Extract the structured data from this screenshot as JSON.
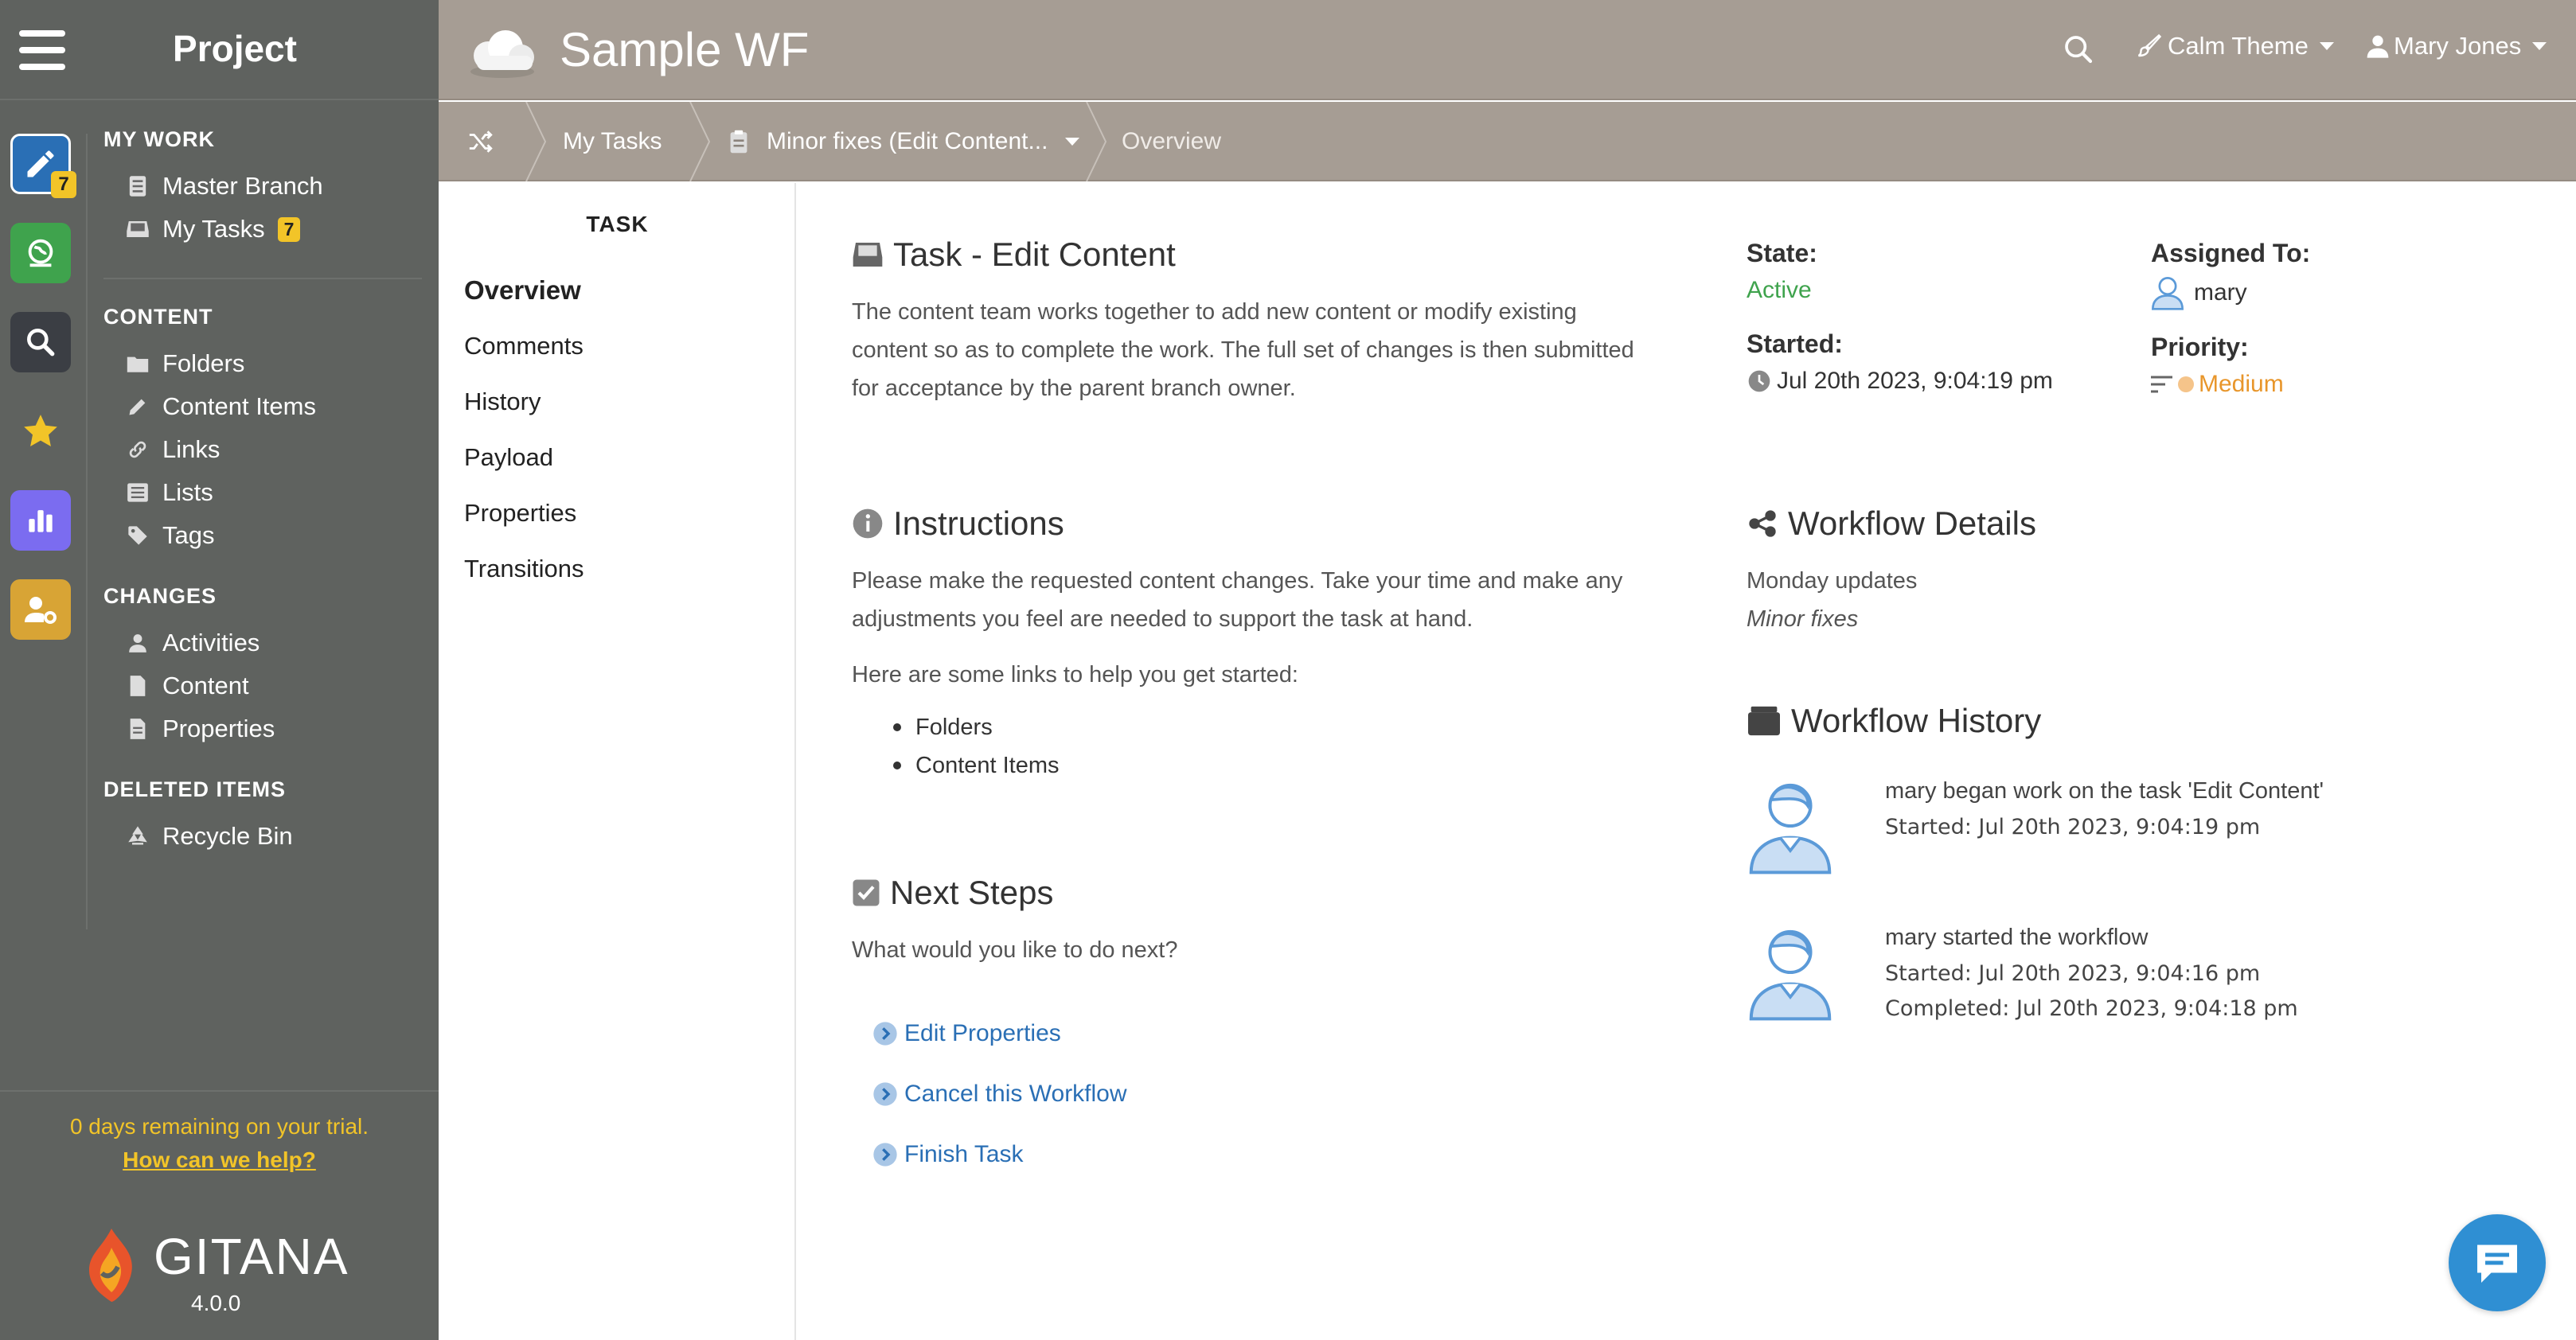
{
  "sidebar": {
    "title": "Project",
    "rail": [
      {
        "name": "edit-icon",
        "badge": "7",
        "color": "#2a6fb5"
      },
      {
        "name": "globe-icon",
        "color": "#3fa34d"
      },
      {
        "name": "search-icon",
        "color": "#3b3e44"
      },
      {
        "name": "star-icon",
        "color": "#f2c428"
      },
      {
        "name": "chart-icon",
        "color": "#7b6cf0"
      },
      {
        "name": "user-gear-icon",
        "color": "#d8a435"
      }
    ],
    "sections": {
      "mywork": {
        "heading": "MY WORK",
        "items": [
          "Master Branch",
          "My Tasks"
        ],
        "my_tasks_badge": "7"
      },
      "content": {
        "heading": "CONTENT",
        "items": [
          "Folders",
          "Content Items",
          "Links",
          "Lists",
          "Tags"
        ]
      },
      "changes": {
        "heading": "CHANGES",
        "items": [
          "Activities",
          "Content",
          "Properties"
        ]
      },
      "deleted": {
        "heading": "DELETED ITEMS",
        "items": [
          "Recycle Bin"
        ]
      }
    },
    "footer": {
      "trial": "0 days remaining on your trial.",
      "help": "How can we help?",
      "brand": "GITANA",
      "version": "4.0.0"
    }
  },
  "topbar": {
    "title": "Sample WF",
    "theme": "Calm Theme",
    "user": "Mary Jones"
  },
  "breadcrumb": {
    "items": [
      "My Tasks",
      "Minor fixes (Edit Content...",
      "Overview"
    ]
  },
  "taskmenu": {
    "heading": "TASK",
    "items": [
      "Overview",
      "Comments",
      "History",
      "Payload",
      "Properties",
      "Transitions"
    ]
  },
  "main": {
    "task": {
      "title": "Task - Edit Content",
      "desc": [
        "The content team works together to add new content or modify existing",
        "content so as to complete the work. The full set of changes is then submitted",
        "for acceptance by the parent branch owner."
      ]
    },
    "state": {
      "label": "State:",
      "value": "Active",
      "color": "#3fa34d"
    },
    "started": {
      "label": "Started:",
      "value": "Jul 20th 2023, 9:04:19 pm"
    },
    "assigned": {
      "label": "Assigned To:",
      "value": "mary"
    },
    "priority": {
      "label": "Priority:",
      "value": "Medium",
      "color": "#e8962b"
    },
    "instructions": {
      "title": "Instructions",
      "text": [
        "Please make the requested content changes. Take your time and make any",
        "adjustments you feel are needed to support the task at hand."
      ],
      "links_intro": "Here are some links to help you get started:",
      "links": [
        "Folders",
        "Content Items"
      ]
    },
    "next_steps": {
      "title": "Next Steps",
      "question": "What would you like to do next?",
      "actions": [
        "Edit Properties",
        "Cancel this Workflow",
        "Finish Task"
      ]
    },
    "workflow_details": {
      "title": "Workflow Details",
      "name": "Monday updates",
      "subtitle": "Minor fixes"
    },
    "workflow_history": {
      "title": "Workflow History",
      "entries": [
        {
          "text": "mary began work on the task 'Edit Content'",
          "started": "Started: Jul 20th 2023, 9:04:19 pm",
          "completed": ""
        },
        {
          "text": "mary started the workflow",
          "started": "Started: Jul 20th 2023, 9:04:16 pm",
          "completed": "Completed: Jul 20th 2023, 9:04:18 pm"
        }
      ]
    }
  }
}
